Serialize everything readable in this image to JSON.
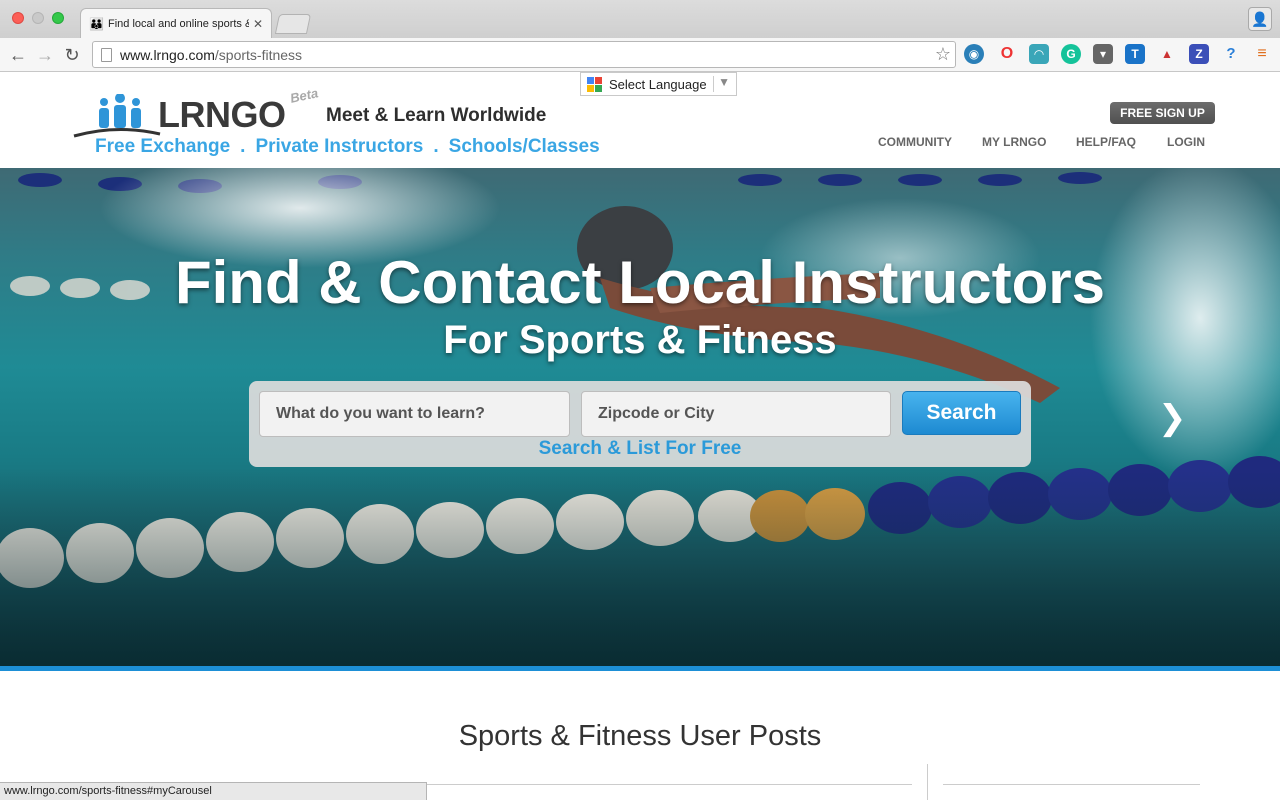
{
  "browser": {
    "tab_title": "Find local and online sports &",
    "url_host": "www.lrngo.com",
    "url_path": "/sports-fitness",
    "status_url": "www.lrngo.com/sports-fitness#myCarousel"
  },
  "header": {
    "language_label": "Select Language",
    "logo_text": "LRNGO",
    "logo_badge": "Beta",
    "tagline": "Meet & Learn Worldwide",
    "subnav": [
      "Free Exchange",
      "Private Instructors",
      "Schools/Classes"
    ],
    "subnav_separator": ".",
    "signup_label": "FREE SIGN UP",
    "nav": [
      "COMMUNITY",
      "MY LRNGO",
      "HELP/FAQ",
      "LOGIN"
    ]
  },
  "hero": {
    "headline": "Find & Contact Local Instructors",
    "subheadline": "For Sports & Fitness",
    "search_learn_placeholder": "What do you want to learn?",
    "search_location_placeholder": "Zipcode or City",
    "search_button": "Search",
    "list_free_link": "Search & List For Free"
  },
  "section": {
    "title": "Sports & Fitness User Posts"
  },
  "colors": {
    "accent_blue": "#3aa6e4",
    "button_blue": "#1d8ad1",
    "hero_bar": "#1d8fd6"
  }
}
